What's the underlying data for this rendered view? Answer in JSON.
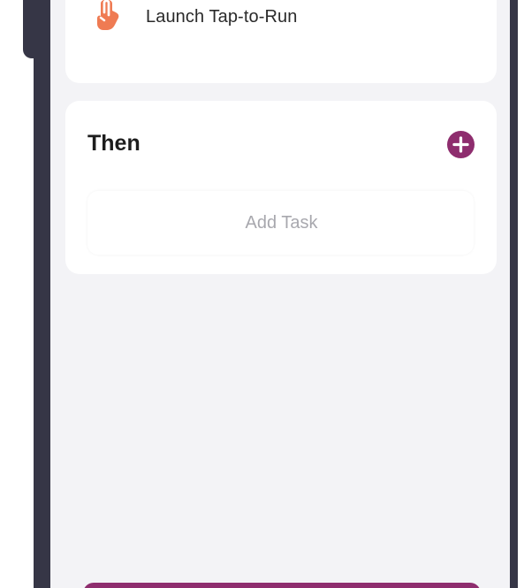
{
  "if_card": {
    "launch_label": "Launch Tap-to-Run",
    "icon": "tap-hand-icon",
    "icon_color": "#ef7b53"
  },
  "then_card": {
    "title": "Then",
    "add_icon": "plus-circle-icon",
    "add_task_label": "Add Task",
    "accent": "#8e2d6e"
  },
  "footer": {
    "button_color": "#8e2d6e"
  },
  "colors": {
    "frame": "#363646",
    "screen_background": "#f3f3f6",
    "card_background": "#ffffff",
    "muted_text": "#a8a8ae"
  }
}
